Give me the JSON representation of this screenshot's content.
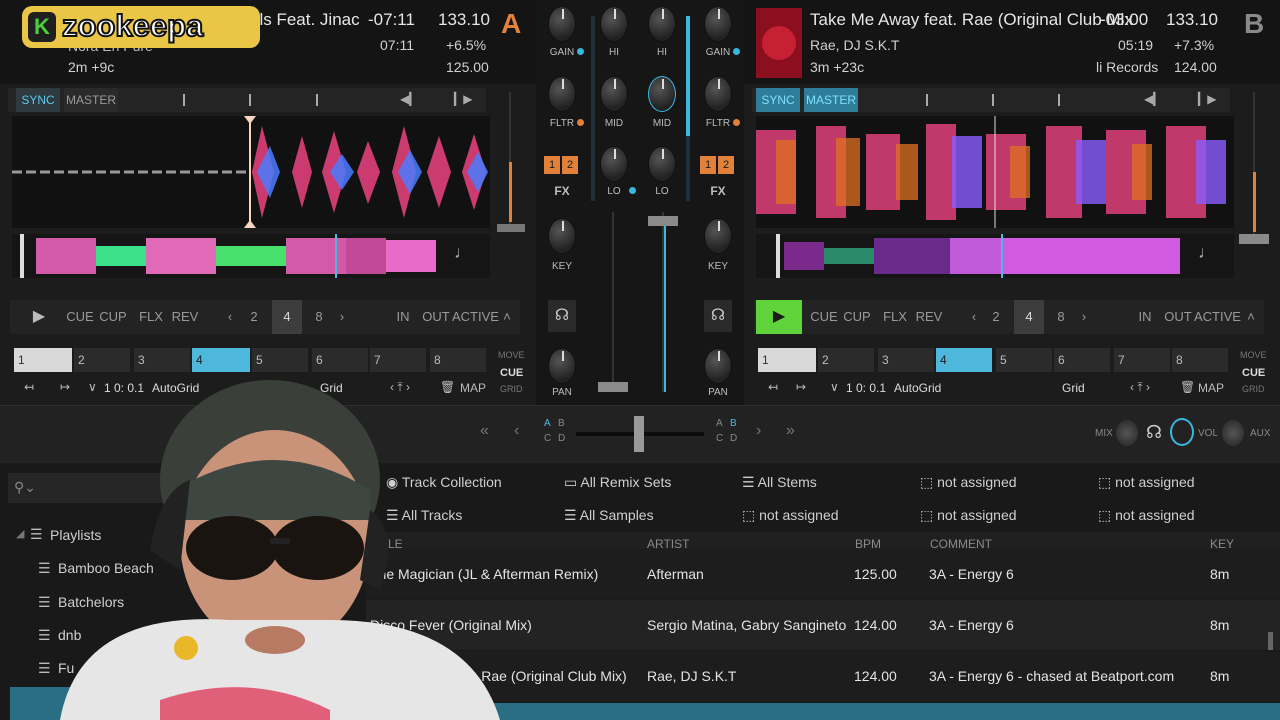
{
  "logo": {
    "k": "K",
    "text": "zookeepa"
  },
  "deckA": {
    "letter": "A",
    "title": "els Feat. Jinac",
    "artist": "Nora En Pure",
    "key_shift": "2m +9c",
    "remaining": "-07:11",
    "elapsed": "07:11",
    "bpm": "133.10",
    "pitch": "+6.5%",
    "orig_bpm": "125.00",
    "sync": "SYNC",
    "master": "MASTER",
    "play": "▶",
    "cue": "CUE",
    "cup": "CUP",
    "flx": "FLX",
    "rev": "REV",
    "loops": [
      "2",
      "4",
      "8"
    ],
    "in": "IN",
    "out": "OUT",
    "active": "ACTIVE",
    "cues": [
      "1",
      "2",
      "3",
      "4",
      "5",
      "6",
      "7",
      "8"
    ],
    "move": "MOVE",
    "cue_mode": "CUE",
    "grid_mode": "GRID",
    "grid_value": "1 0: 0.1",
    "autogrid": "AutoGrid",
    "grid": "Grid",
    "map": "MAP"
  },
  "deckB": {
    "letter": "B",
    "title": "Take Me Away feat. Rae (Original Club Mix",
    "artist": "Rae, DJ S.K.T",
    "key_shift": "3m +23c",
    "label": "li Records",
    "remaining": "-03:00",
    "elapsed": "05:19",
    "bpm": "133.10",
    "pitch": "+7.3%",
    "orig_bpm": "124.00",
    "sync": "SYNC",
    "master": "MASTER",
    "play": "▶",
    "cue": "CUE",
    "cup": "CUP",
    "flx": "FLX",
    "rev": "REV",
    "loops": [
      "2",
      "4",
      "8"
    ],
    "in": "IN",
    "out": "OUT",
    "active": "ACTIVE",
    "cues": [
      "1",
      "2",
      "3",
      "4",
      "5",
      "6",
      "7",
      "8"
    ],
    "move": "MOVE",
    "cue_mode": "CUE",
    "grid_mode": "GRID",
    "grid_value": "1 0: 0.1",
    "autogrid": "AutoGrid",
    "grid": "Grid",
    "map": "MAP"
  },
  "mixer": {
    "gain": "GAIN",
    "hi": "HI",
    "mid": "MID",
    "lo": "LO",
    "fltr": "FLTR",
    "fx": "FX",
    "key": "KEY",
    "pan": "PAN",
    "fx1": "1",
    "fx2": "2"
  },
  "crossfader": {
    "a": "A",
    "b": "B",
    "c": "C",
    "d": "D",
    "mix": "MIX",
    "vol": "VOL",
    "aux": "AUX"
  },
  "browser": {
    "favorites_row1": [
      "Track Collection",
      "All Remix Sets",
      "All Stems",
      "not assigned",
      "not assigned"
    ],
    "favorites_row2": [
      "All Tracks",
      "All Samples",
      "not assigned",
      "not assigned",
      "not assigned"
    ],
    "columns": {
      "title": "TITLE",
      "artist": "ARTIST",
      "bpm": "BPM",
      "comment": "COMMENT",
      "key": "KEY"
    },
    "tree": {
      "playlists": "Playlists",
      "items": [
        "Bamboo Beach",
        "Batchelors",
        "dnb",
        "Fu"
      ]
    },
    "rows": [
      {
        "title": "The Magician (JL & Afterman Remix)",
        "artist": "Afterman",
        "bpm": "125.00",
        "comment": "3A - Energy 6",
        "key": "8m"
      },
      {
        "title": "Disco Fever (Original Mix)",
        "artist": "Sergio Matina, Gabry Sangineto",
        "bpm": "124.00",
        "comment": "3A - Energy 6",
        "key": "8m"
      },
      {
        "title": "eat. Rae (Original Club Mix)",
        "artist": "Rae, DJ S.K.T",
        "bpm": "124.00",
        "comment": "3A - Energy 6 - chased at Beatport.com",
        "key": "8m"
      }
    ]
  },
  "colors": {
    "accent": "#3ab7e0",
    "deck_letter": "#e2823a",
    "play_green": "#5fd33a",
    "highlight": "#4db8dc"
  }
}
